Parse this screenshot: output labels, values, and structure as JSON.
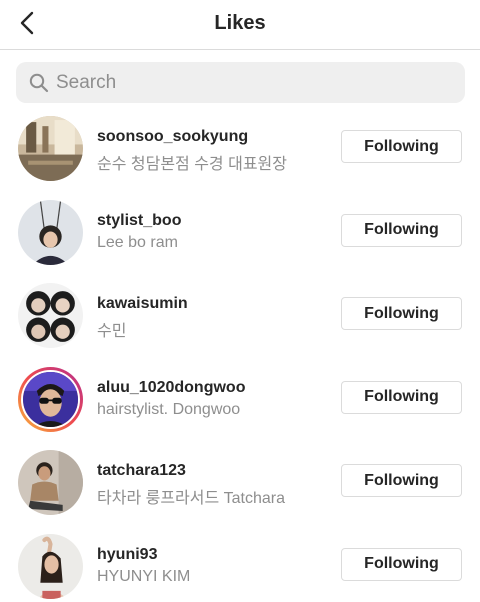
{
  "header": {
    "title": "Likes"
  },
  "search": {
    "placeholder": "Search",
    "value": ""
  },
  "users": [
    {
      "username": "soonsoo_sookyung",
      "subtitle": "순수 청담본점 수경 대표원장",
      "button": "Following",
      "story_ring": false
    },
    {
      "username": "stylist_boo",
      "subtitle": "Lee bo ram",
      "button": "Following",
      "story_ring": false
    },
    {
      "username": "kawaisumin",
      "subtitle": "수민",
      "button": "Following",
      "story_ring": false
    },
    {
      "username": "aluu_1020dongwoo",
      "subtitle": "hairstylist. Dongwoo",
      "button": "Following",
      "story_ring": true
    },
    {
      "username": "tatchara123",
      "subtitle": "타차라 룽프라서드 Tatchara",
      "button": "Following",
      "story_ring": false
    },
    {
      "username": "hyuni93",
      "subtitle": "HYUNYI KIM",
      "button": "Following",
      "story_ring": false
    }
  ],
  "colors": {
    "text": "#262626",
    "secondary": "#8e8e8e",
    "border": "#dbdbdb",
    "search_bg": "#efefef"
  }
}
